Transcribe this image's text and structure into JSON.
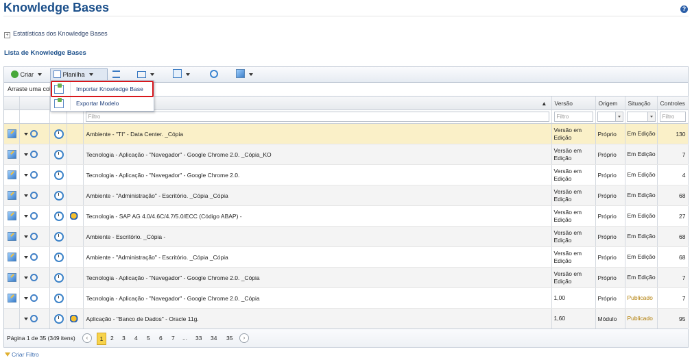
{
  "page": {
    "title": "Knowledge Bases",
    "help": "?"
  },
  "stats_link": "Estatísticas dos Knowledge Bases",
  "list_title": "Lista de Knowledge Bases",
  "toolbar": {
    "create_label": "Criar",
    "sheet_label": "Planilha"
  },
  "groupbar_text": "Arraste uma col",
  "menu": {
    "items": [
      "Importar Knowledge Base",
      "Exportar Modelo"
    ]
  },
  "columns": {
    "sort_arrow": "▲",
    "version": "Versão",
    "origin": "Origem",
    "status": "Situação",
    "controls": "Controles"
  },
  "filter_placeholder": "Filtro",
  "rows": [
    {
      "name": "Ambiente - \"TI\" - Data Center. _Cópia",
      "version": "Versão em Edição",
      "origin": "Próprio",
      "status": "Em Edição",
      "controls": "130",
      "edit_icon": true,
      "system_icon": false
    },
    {
      "name": "Tecnologia - Aplicação - \"Navegador\" - Google Chrome 2.0. _Cópia_KO",
      "version": "Versão em Edição",
      "origin": "Próprio",
      "status": "Em Edição",
      "controls": "7",
      "edit_icon": true,
      "system_icon": false
    },
    {
      "name": "Tecnologia - Aplicação - \"Navegador\" - Google Chrome 2.0.",
      "version": "Versão em Edição",
      "origin": "Próprio",
      "status": "Em Edição",
      "controls": "4",
      "edit_icon": true,
      "system_icon": false
    },
    {
      "name": "Ambiente - \"Administração\" - Escritório. _Cópia _Cópia",
      "version": "Versão em Edição",
      "origin": "Próprio",
      "status": "Em Edição",
      "controls": "68",
      "edit_icon": true,
      "system_icon": false
    },
    {
      "name": "Tecnologia - SAP AG 4.0/4.6C/4.7/5.0/ECC (Código ABAP) -",
      "version": "Versão em Edição",
      "origin": "Próprio",
      "status": "Em Edição",
      "controls": "27",
      "edit_icon": true,
      "system_icon": true
    },
    {
      "name": "Ambiente - Escritório. _Cópia -",
      "version": "Versão em Edição",
      "origin": "Próprio",
      "status": "Em Edição",
      "controls": "68",
      "edit_icon": true,
      "system_icon": false
    },
    {
      "name": "Ambiente - \"Administração\" - Escritório. _Cópia _Cópia",
      "version": "Versão em Edição",
      "origin": "Próprio",
      "status": "Em Edição",
      "controls": "68",
      "edit_icon": true,
      "system_icon": false
    },
    {
      "name": "Tecnologia - Aplicação - \"Navegador\" - Google Chrome 2.0. _Cópia",
      "version": "Versão em Edição",
      "origin": "Próprio",
      "status": "Em Edição",
      "controls": "7",
      "edit_icon": true,
      "system_icon": false
    },
    {
      "name": "Tecnologia - Aplicação - \"Navegador\" - Google Chrome 2.0. _Cópia",
      "version": "1,00",
      "origin": "Próprio",
      "status": "Publicado",
      "controls": "7",
      "edit_icon": true,
      "system_icon": false
    },
    {
      "name": "Aplicação - \"Banco de Dados\" - Oracle 11g.",
      "version": "1,60",
      "origin": "Módulo",
      "status": "Publicado",
      "controls": "95",
      "edit_icon": false,
      "system_icon": true
    }
  ],
  "pager": {
    "text": "Página 1 de 35 (349 itens)",
    "pages": [
      "1",
      "2",
      "3",
      "4",
      "5",
      "6",
      "7",
      "...",
      "33",
      "34",
      "35"
    ],
    "current": "1",
    "prev": "‹",
    "next": "›"
  },
  "create_filter": "Criar Filtro"
}
